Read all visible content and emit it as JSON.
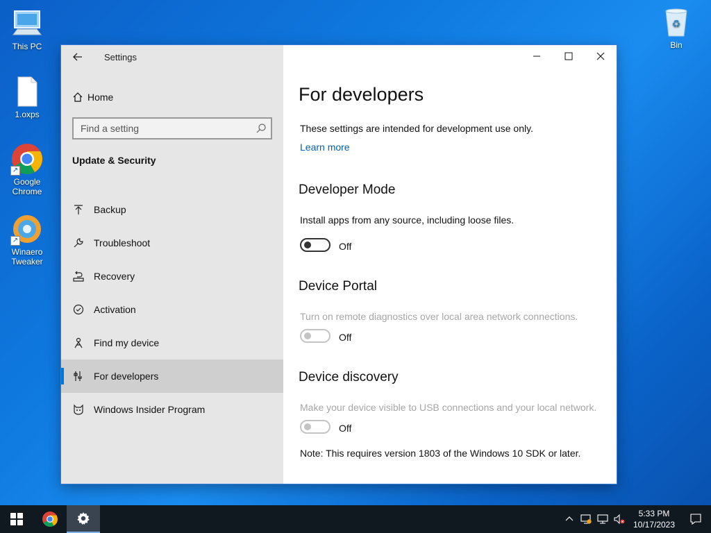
{
  "desktop": {
    "icons": [
      {
        "label": "This PC"
      },
      {
        "label": "1.oxps"
      },
      {
        "label": "Google Chrome"
      },
      {
        "label": "Winaero Tweaker"
      },
      {
        "label": "Bin"
      }
    ]
  },
  "window": {
    "app_title": "Settings",
    "home_label": "Home",
    "search_placeholder": "Find a setting",
    "section_title": "Update & Security",
    "nav_items": [
      {
        "label": "Backup",
        "icon": "backup-arrow-icon"
      },
      {
        "label": "Troubleshoot",
        "icon": "wrench-icon"
      },
      {
        "label": "Recovery",
        "icon": "recovery-icon"
      },
      {
        "label": "Activation",
        "icon": "check-circle-icon"
      },
      {
        "label": "Find my device",
        "icon": "person-locate-icon"
      },
      {
        "label": "For developers",
        "icon": "developer-tools-icon",
        "active": true
      },
      {
        "label": "Windows Insider Program",
        "icon": "insider-cat-icon"
      }
    ]
  },
  "content": {
    "title": "For developers",
    "intro": "These settings are intended for development use only.",
    "learn_more": "Learn more",
    "developer_mode": {
      "heading": "Developer Mode",
      "description": "Install apps from any source, including loose files.",
      "toggle_state": "Off"
    },
    "device_portal": {
      "heading": "Device Portal",
      "description": "Turn on remote diagnostics over local area network connections.",
      "toggle_state": "Off"
    },
    "device_discovery": {
      "heading": "Device discovery",
      "description": "Make your device visible to USB connections and your local network.",
      "toggle_state": "Off",
      "note": "Note: This requires version 1803 of the Windows 10 SDK or later."
    }
  },
  "taskbar": {
    "time": "5:33 PM",
    "date": "10/17/2023"
  },
  "colors": {
    "accent": "#0078d7",
    "link": "#0063b1",
    "sidebar_bg": "#e6e6e6",
    "taskbar_bg": "#101820"
  }
}
